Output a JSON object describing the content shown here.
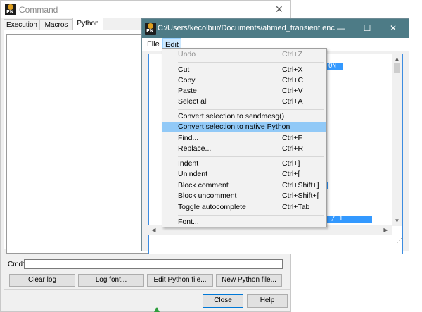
{
  "command_window": {
    "title": "Command",
    "close_glyph": "✕",
    "icon_text": "EN",
    "tabs": [
      {
        "label": "Execution"
      },
      {
        "label": "Macros"
      },
      {
        "label": "Python"
      }
    ],
    "cmd_label": "Cmd:",
    "cmd_value": "",
    "buttons": {
      "clear_log": "Clear log",
      "log_font": "Log font...",
      "edit_python_file": "Edit Python file...",
      "new_python_file": "New Python file..."
    },
    "close_button": "Close",
    "help_button": "Help"
  },
  "editor_window": {
    "title": "C:/Users/kecolbur/Documents/ahmed_transient.enc",
    "icon_text": "EN",
    "controls": {
      "minimize": "—",
      "maximize": "☐",
      "close": "✕"
    },
    "menu": {
      "file": "File",
      "edit": "Edit"
    },
    "visible_fragments": {
      "top": "ON",
      "bottom": "/ 1"
    },
    "scroll_arrows": {
      "up": "▲",
      "down": "▼",
      "left": "◀",
      "right": "▶"
    }
  },
  "edit_menu": {
    "items": [
      {
        "label": "Undo",
        "shortcut": "Ctrl+Z",
        "enabled": false
      },
      {
        "label": "Cut",
        "shortcut": "Ctrl+X"
      },
      {
        "label": "Copy",
        "shortcut": "Ctrl+C"
      },
      {
        "label": "Paste",
        "shortcut": "Ctrl+V"
      },
      {
        "label": "Select all",
        "shortcut": "Ctrl+A"
      },
      {
        "label": "Convert selection to sendmesg()",
        "shortcut": ""
      },
      {
        "label": "Convert selection to native Python",
        "shortcut": "",
        "highlighted": true
      },
      {
        "label": "Find...",
        "shortcut": "Ctrl+F"
      },
      {
        "label": "Replace...",
        "shortcut": "Ctrl+R"
      },
      {
        "label": "Indent",
        "shortcut": "Ctrl+]"
      },
      {
        "label": "Unindent",
        "shortcut": "Ctrl+["
      },
      {
        "label": "Block comment",
        "shortcut": "Ctrl+Shift+]"
      },
      {
        "label": "Block uncomment",
        "shortcut": "Ctrl+Shift+["
      },
      {
        "label": "Toggle autocomplete",
        "shortcut": "Ctrl+Tab"
      },
      {
        "label": "Font...",
        "shortcut": ""
      }
    ]
  },
  "colors": {
    "editor_titlebar": "#4d7b86",
    "menu_highlight": "#91c9f7",
    "selection": "#3399ff"
  }
}
